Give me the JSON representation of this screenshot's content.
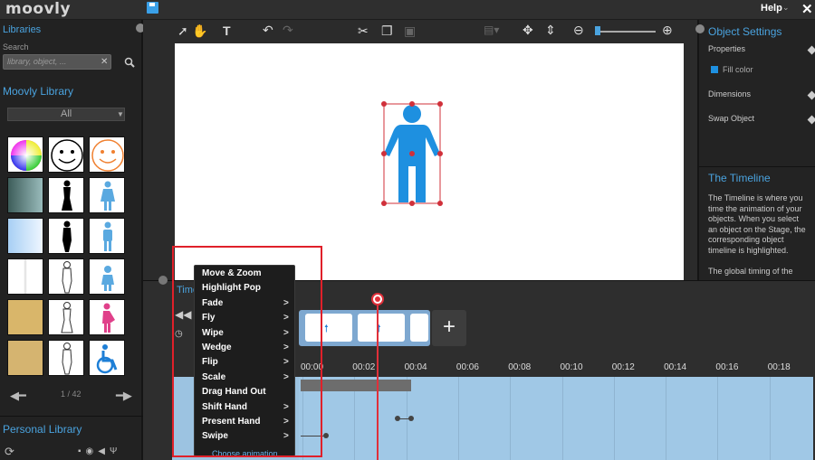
{
  "app": {
    "logo": "moovly"
  },
  "header": {
    "help_label": "Help",
    "help_arrow": "⌄",
    "close_glyph": "✕"
  },
  "libraries": {
    "title": "Libraries",
    "search_label": "Search",
    "search_placeholder": "library, object, ...",
    "search_clear": "✕",
    "moovly_library_title": "Moovly Library",
    "category_selected": "All",
    "pager": "1 / 42",
    "personal_library_title": "Personal Library"
  },
  "object_settings": {
    "title": "Object Settings",
    "properties": "Properties",
    "fill_color": "Fill color",
    "dimensions": "Dimensions",
    "swap_object": "Swap Object"
  },
  "timeline_help": {
    "title": "The Timeline",
    "paragraph1": "The Timeline is where you time the animation of your objects. When you select an object on the Stage, the corresponding object timeline is highlighted.",
    "paragraph2": "The global timing of the"
  },
  "timeline": {
    "title": "Timeline",
    "row_label": "mo",
    "ticks": [
      "00:00",
      "00:02",
      "00:04",
      "00:06",
      "00:08",
      "00:10",
      "00:12",
      "00:14",
      "00:16",
      "00:18"
    ],
    "add_label": "+",
    "clock_dash": "—"
  },
  "animation_menu": {
    "items": [
      {
        "label": "Move & Zoom",
        "submenu": ""
      },
      {
        "label": "Highlight Pop",
        "submenu": ""
      },
      {
        "label": "Fade",
        "submenu": ">"
      },
      {
        "label": "Fly",
        "submenu": ">"
      },
      {
        "label": "Wipe",
        "submenu": ">"
      },
      {
        "label": "Wedge",
        "submenu": ">"
      },
      {
        "label": "Flip",
        "submenu": ">"
      },
      {
        "label": "Scale",
        "submenu": ">"
      },
      {
        "label": "Drag Hand Out",
        "submenu": ""
      },
      {
        "label": "Shift Hand",
        "submenu": ">"
      },
      {
        "label": "Present Hand",
        "submenu": ">"
      },
      {
        "label": "Swipe",
        "submenu": ">"
      }
    ],
    "footer": "Choose animation"
  },
  "colors": {
    "accent": "#4aa3df",
    "selection": "#e0202a",
    "figure": "#1e90e0"
  }
}
